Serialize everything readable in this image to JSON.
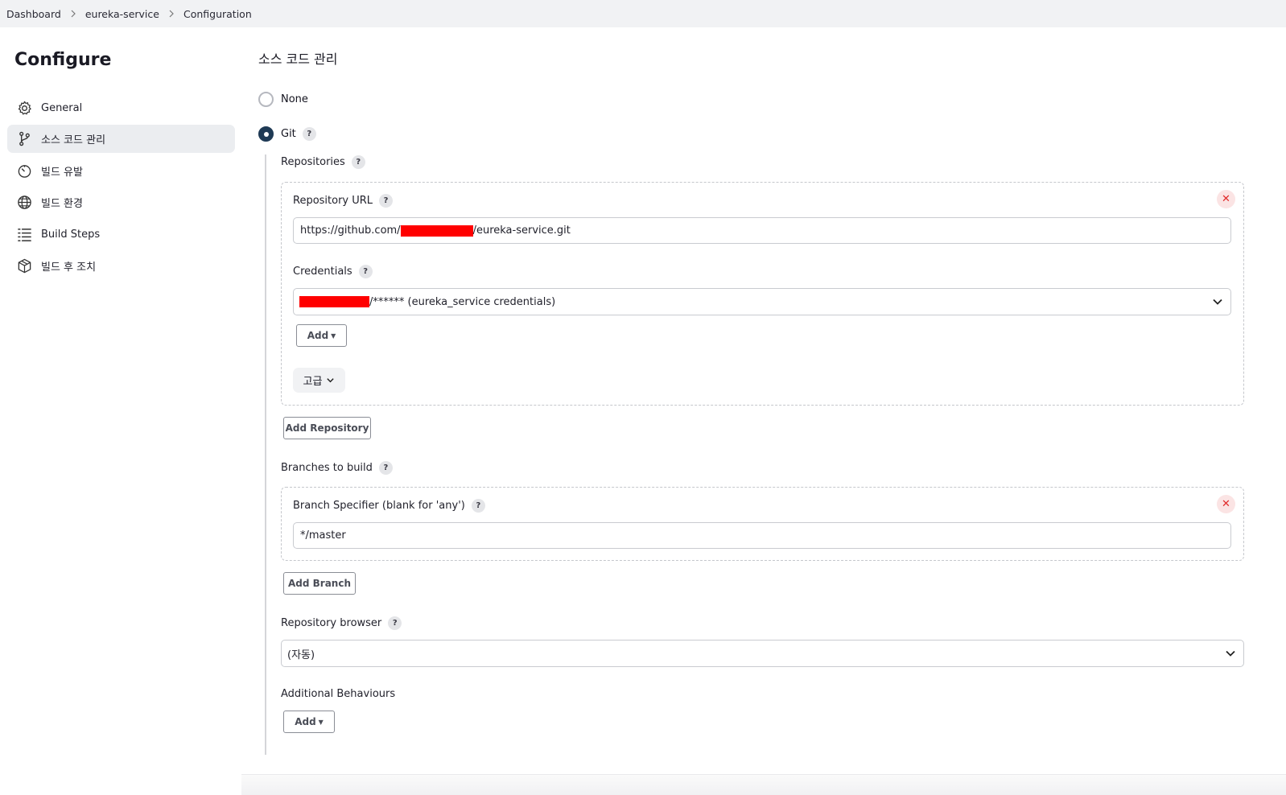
{
  "breadcrumb": {
    "items": [
      "Dashboard",
      "eureka-service",
      "Configuration"
    ]
  },
  "sidebar": {
    "title": "Configure",
    "items": [
      {
        "label": "General",
        "icon": "gear-icon"
      },
      {
        "label": "소스 코드 관리",
        "icon": "git-branch-icon"
      },
      {
        "label": "빌드 유발",
        "icon": "timer-icon"
      },
      {
        "label": "빌드 환경",
        "icon": "globe-icon"
      },
      {
        "label": "Build Steps",
        "icon": "list-icon"
      },
      {
        "label": "빌드 후 조치",
        "icon": "package-icon"
      }
    ],
    "active_index": 1
  },
  "scm": {
    "title": "소스 코드 관리",
    "options": [
      {
        "label": "None",
        "selected": false
      },
      {
        "label": "Git",
        "selected": true
      }
    ],
    "help_glyph": "?",
    "repositories": {
      "label": "Repositories",
      "url_label": "Repository URL",
      "url_prefix": "https://github.com/",
      "url_suffix": "/eureka-service.git",
      "credentials_label": "Credentials",
      "credentials_value": "/****** (eureka_service credentials)",
      "add_label": "Add",
      "advanced_label": "고급",
      "add_repository_label": "Add Repository"
    },
    "branches": {
      "label": "Branches to build",
      "specifier_label": "Branch Specifier (blank for 'any')",
      "specifier_value": "*/master",
      "add_branch_label": "Add Branch"
    },
    "browser": {
      "label": "Repository browser",
      "value": "(자동)"
    },
    "additional": {
      "label": "Additional Behaviours",
      "add_label": "Add"
    }
  },
  "colors": {
    "accent": "#1f3a55",
    "redaction": "#ff0000",
    "delete": "#e02a2a"
  }
}
